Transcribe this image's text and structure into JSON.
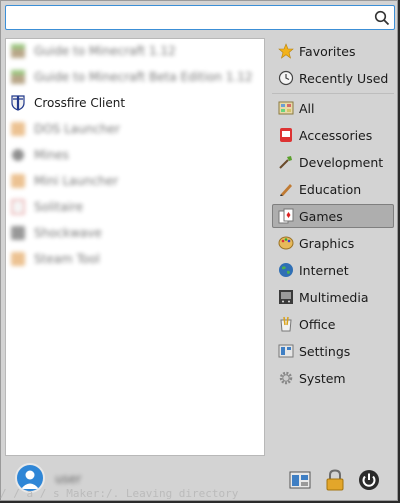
{
  "search": {
    "value": "",
    "placeholder": ""
  },
  "app_list": {
    "items": [
      {
        "label": "Guide to Minecraft 1.12",
        "icon": "minecraft-icon",
        "blurred": true
      },
      {
        "label": "Guide to Minecraft Beta Edition 1.12",
        "icon": "minecraft-icon",
        "blurred": true
      },
      {
        "label": "Crossfire Client",
        "icon": "crossfire-shield-icon",
        "blurred": false
      },
      {
        "label": "DOS Launcher",
        "icon": "game-icon",
        "blurred": true
      },
      {
        "label": "Mines",
        "icon": "mines-icon",
        "blurred": true
      },
      {
        "label": "Mini Launcher",
        "icon": "game-icon",
        "blurred": true
      },
      {
        "label": "Solitaire",
        "icon": "cards-icon",
        "blurred": true
      },
      {
        "label": "Shockwave",
        "icon": "game-icon",
        "blurred": true
      },
      {
        "label": "Steam Tool",
        "icon": "game-icon",
        "blurred": true
      }
    ]
  },
  "categories": {
    "items": [
      {
        "label": "Favorites",
        "icon": "star-icon",
        "selected": false
      },
      {
        "label": "Recently Used",
        "icon": "clock-icon",
        "selected": false
      },
      {
        "label": "All",
        "icon": "all-apps-icon",
        "selected": false
      },
      {
        "label": "Accessories",
        "icon": "accessories-icon",
        "selected": false
      },
      {
        "label": "Development",
        "icon": "development-icon",
        "selected": false
      },
      {
        "label": "Education",
        "icon": "education-icon",
        "selected": false
      },
      {
        "label": "Games",
        "icon": "games-icon",
        "selected": true
      },
      {
        "label": "Graphics",
        "icon": "graphics-icon",
        "selected": false
      },
      {
        "label": "Internet",
        "icon": "globe-icon",
        "selected": false
      },
      {
        "label": "Multimedia",
        "icon": "multimedia-icon",
        "selected": false
      },
      {
        "label": "Office",
        "icon": "office-icon",
        "selected": false
      },
      {
        "label": "Settings",
        "icon": "settings-icon",
        "selected": false
      },
      {
        "label": "System",
        "icon": "system-gear-icon",
        "selected": false
      }
    ]
  },
  "bottom_bar": {
    "user_name": "user",
    "settings_button": "settings-manager-icon",
    "lock_button": "lock-icon",
    "power_button": "power-icon"
  },
  "background_terminal": {
    "text": "/ /  a / s  Maker:/.  Leaving directory"
  },
  "colors": {
    "accent": "#3c8fd6",
    "panel_bg": "#d3d3d3",
    "list_bg": "#ffffff",
    "selected_bg": "#aeaeae"
  }
}
